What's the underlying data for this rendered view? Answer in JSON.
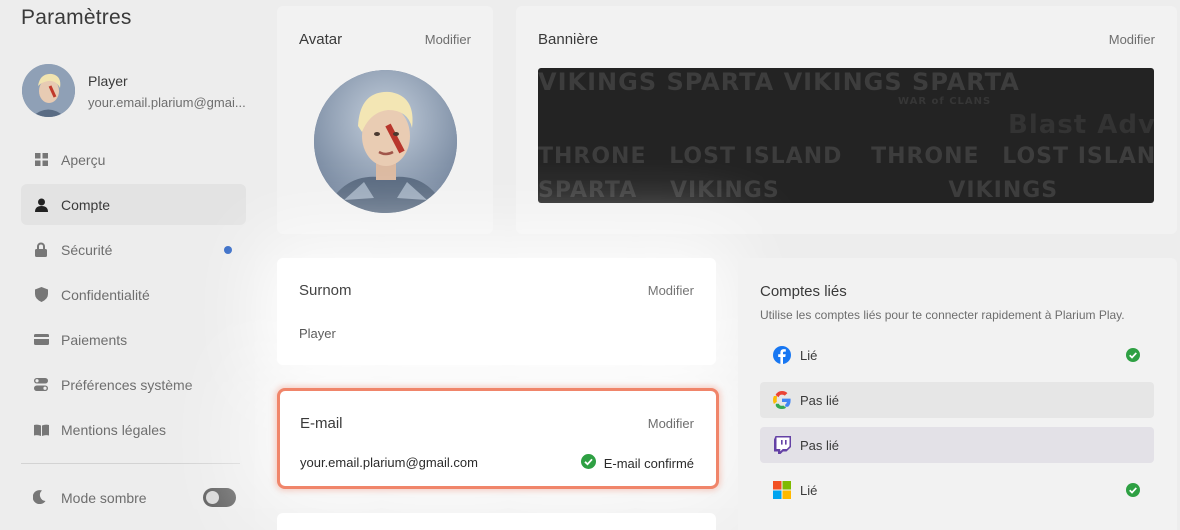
{
  "sidebar": {
    "title": "Paramètres",
    "user": {
      "name": "Player",
      "email": "your.email.plarium@gmai..."
    },
    "items": [
      {
        "label": "Aperçu",
        "icon": "grid-icon"
      },
      {
        "label": "Compte",
        "icon": "user-icon",
        "active": true
      },
      {
        "label": "Sécurité",
        "icon": "lock-icon",
        "badge": true
      },
      {
        "label": "Confidentialité",
        "icon": "shield-icon"
      },
      {
        "label": "Paiements",
        "icon": "card-icon"
      },
      {
        "label": "Préférences système",
        "icon": "toggles-icon"
      },
      {
        "label": "Mentions légales",
        "icon": "book-icon"
      }
    ],
    "dark_mode": {
      "label": "Mode sombre",
      "enabled": false
    }
  },
  "avatar_card": {
    "title": "Avatar",
    "edit": "Modifier"
  },
  "banner_card": {
    "title": "Bannière",
    "edit": "Modifier",
    "banner_text": [
      "VIKINGS",
      "SPARTA",
      "WAR of CLANS",
      "THRONE",
      "LOST ISLAND",
      "Blast Adventure"
    ]
  },
  "nickname_card": {
    "title": "Surnom",
    "edit": "Modifier",
    "value": "Player"
  },
  "email_card": {
    "title": "E-mail",
    "edit": "Modifier",
    "value": "your.email.plarium@gmail.com",
    "status": "E-mail confirmé",
    "status_color": "#2ea043"
  },
  "linked_accounts": {
    "title": "Comptes liés",
    "subtitle": "Utilise les comptes liés pour te connecter rapidement à Plarium Play.",
    "accounts": [
      {
        "provider": "Facebook",
        "icon": "facebook-icon",
        "status": "Lié",
        "linked": true
      },
      {
        "provider": "Google",
        "icon": "google-icon",
        "status": "Pas lié",
        "linked": false
      },
      {
        "provider": "Twitch",
        "icon": "twitch-icon",
        "status": "Pas lié",
        "linked": false
      },
      {
        "provider": "Microsoft",
        "icon": "microsoft-icon",
        "status": "Lié",
        "linked": true
      }
    ]
  },
  "colors": {
    "accent_highlight": "#f0856a",
    "badge_blue": "#2f66c5",
    "check_green": "#2ea043"
  }
}
